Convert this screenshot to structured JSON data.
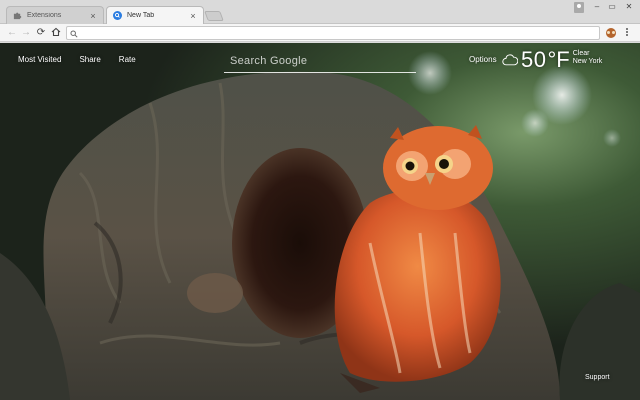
{
  "browser": {
    "tabs": [
      {
        "title": "Extensions",
        "icon": "puzzle-icon",
        "active": false
      },
      {
        "title": "New Tab",
        "icon": "search-tab-icon",
        "active": true
      }
    ],
    "window_controls": {
      "minimize": "–",
      "maximize": "▭",
      "close": "✕"
    },
    "address": {
      "value": "",
      "placeholder": ""
    }
  },
  "newtab": {
    "nav": {
      "most_visited": "Most Visited",
      "share": "Share",
      "rate": "Rate"
    },
    "search": {
      "placeholder": "Search Google"
    },
    "options_label": "Options",
    "weather": {
      "temperature": "50",
      "unit": "°F",
      "condition": "Clear",
      "location": "New York",
      "icon": "cloud-icon"
    },
    "support_label": "Support"
  },
  "colors": {
    "owl": "#d9622b",
    "foliage": "#3a5a2c",
    "bark": "#4e4a40"
  }
}
